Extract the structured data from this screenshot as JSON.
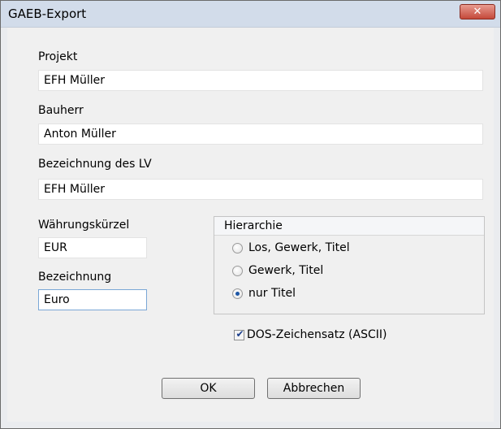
{
  "window": {
    "title": "GAEB-Export",
    "close_symbol": "✕",
    "close_icon": "close-icon"
  },
  "form": {
    "projekt": {
      "label": "Projekt",
      "value": "EFH Müller"
    },
    "bauherr": {
      "label": "Bauherr",
      "value": "Anton Müller"
    },
    "bezeichnung_lv": {
      "label": "Bezeichnung des LV",
      "value": "EFH Müller"
    },
    "waehrungskuerzel": {
      "label": "Währungskürzel",
      "value": "EUR"
    },
    "bezeichnung": {
      "label": "Bezeichnung",
      "value": "Euro"
    }
  },
  "hierarchie": {
    "title": "Hierarchie",
    "options": [
      {
        "label": "Los, Gewerk, Titel",
        "checked": false
      },
      {
        "label": "Gewerk, Titel",
        "checked": false
      },
      {
        "label": "nur Titel",
        "checked": true
      }
    ]
  },
  "dos_checkbox": {
    "label": "DOS-Zeichensatz (ASCII)",
    "checked": true,
    "mark": "✔"
  },
  "buttons": {
    "ok": "OK",
    "cancel": "Abbrechen"
  },
  "colors": {
    "close_button": "#c5493a",
    "titlebar": "#d2dcea",
    "dialog_bg": "#f0f0f0"
  }
}
